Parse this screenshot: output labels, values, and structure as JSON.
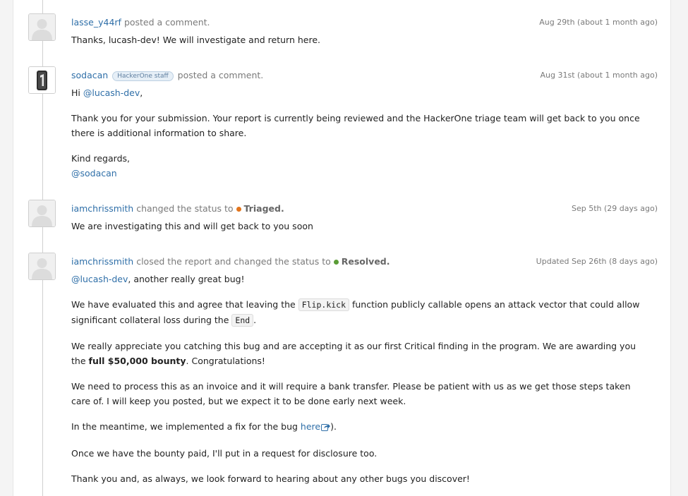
{
  "comments": [
    {
      "user": "lasse_y44rf",
      "action": "posted a comment.",
      "time": "Aug 29th (about 1 month ago)",
      "text": "Thanks, lucash-dev! We will investigate and return here."
    },
    {
      "user": "sodacan",
      "badge": "HackerOne staff",
      "action": "posted a comment.",
      "time": "Aug 31st (about 1 month ago)",
      "greeting_prefix": "Hi ",
      "greeting_mention": "@lucash-dev",
      "greeting_suffix": ",",
      "para1": "Thank you for your submission. Your report is currently being reviewed and the HackerOne triage team will get back to you once there is additional information to share.",
      "signoff": "Kind regards,",
      "signature": "@sodacan"
    },
    {
      "user": "iamchrissmith",
      "action": "changed the status to",
      "status": "Triaged.",
      "status_color": "#e2751d",
      "time": "Sep 5th (29 days ago)",
      "text": "We are investigating this and will get back to you soon"
    },
    {
      "user": "iamchrissmith",
      "action": "closed the report and changed the status to",
      "status": "Resolved.",
      "status_color": "#5a9c36",
      "time": "Updated Sep 26th (8 days ago)",
      "intro_mention": "@lucash-dev",
      "intro_text": ", another really great bug!",
      "p2_a": "We have evaluated this and agree that leaving the ",
      "p2_code1": "Flip.kick",
      "p2_b": " function publicly callable opens an attack vector that could allow significant collateral loss during the ",
      "p2_code2": "End",
      "p2_c": ".",
      "p3_a": "We really appreciate you catching this bug and are accepting it as our first Critical finding in the program. We are awarding you the ",
      "p3_bold": "full $50,000 bounty",
      "p3_c": ". Congratulations!",
      "p4": "We need to process this as an invoice and it will require a bank transfer. Please be patient with us as we get those steps taken care of. I will keep you posted, but we expect it to be done early next week.",
      "p5_a": "In the meantime, we implemented a fix for the bug ",
      "p5_link": "here",
      "p5_c": ").",
      "p6": "Once we have the bounty paid, I'll put in a request for disclosure too.",
      "p7": "Thank you and, as always, we look forward to hearing about any other bugs you discover!"
    }
  ],
  "colors": {
    "link": "#2f6fa8",
    "triaged": "#e2751d",
    "resolved": "#5a9c36"
  },
  "icons": {
    "default_avatar": "person-silhouette-icon",
    "sodacan_avatar": "bottle-avatar-icon",
    "external_link": "external-link-icon"
  }
}
